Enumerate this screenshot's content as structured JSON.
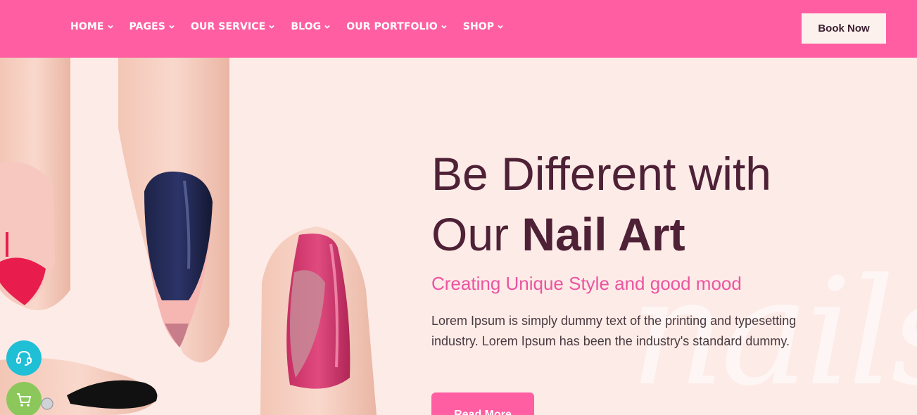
{
  "nav": {
    "items": [
      {
        "label": "HOME"
      },
      {
        "label": "PAGES"
      },
      {
        "label": "OUR SERVICE"
      },
      {
        "label": "BLOG"
      },
      {
        "label": "OUR PORTFOLIO"
      },
      {
        "label": "SHOP"
      }
    ],
    "cta_label": "Book Now"
  },
  "hero": {
    "title_line1": "Be Different with",
    "title_line2_regular": "Our ",
    "title_line2_bold": "Nail Art",
    "subtitle": "Creating Unique Style and good mood",
    "body": "Lorem Ipsum is simply dummy text of the printing and typesetting industry. Lorem Ipsum has been the industry's standard dummy.",
    "button_label": "Read More",
    "watermark": "nails"
  },
  "widgets": {
    "support_icon": "headset-icon",
    "cart_icon": "cart-icon"
  },
  "colors": {
    "nav_bg": "#ff5fa2",
    "hero_bg": "#fdebe7",
    "title": "#4e2136",
    "accent": "#ec54a0"
  }
}
